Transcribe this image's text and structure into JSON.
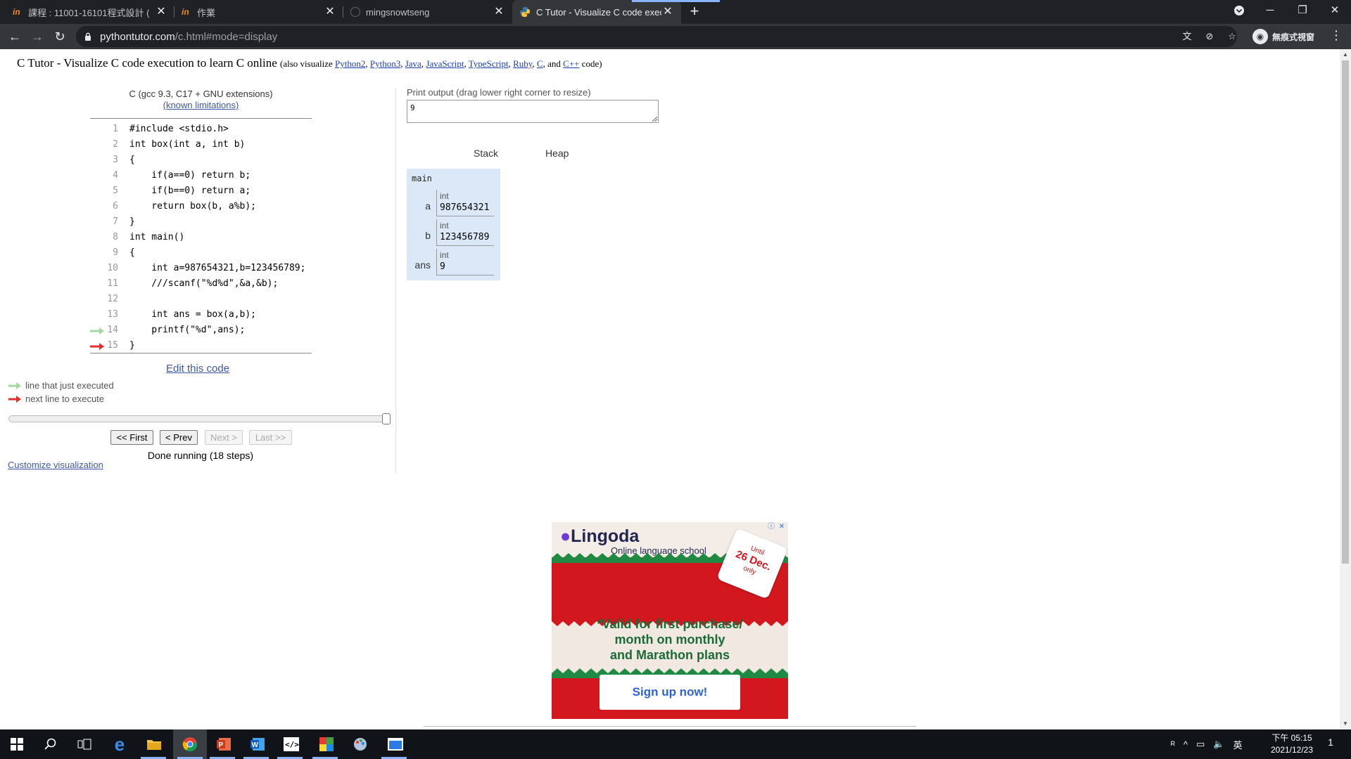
{
  "browser": {
    "tabs": [
      {
        "title": "課程 : 11001-16101程式設計 (",
        "favicon": "in-icon",
        "active": false
      },
      {
        "title": "作業",
        "favicon": "in-icon",
        "active": false
      },
      {
        "title": "mingsnowtseng",
        "favicon": "github-icon",
        "active": false
      },
      {
        "title": "C Tutor - Visualize C code exec",
        "favicon": "python-icon",
        "active": true
      }
    ],
    "new_tab": "+",
    "url_host": "pythontutor.com",
    "url_path": "/c.html#mode=display",
    "profile_label": "無痕式視窗",
    "accent": "#8ab4f8"
  },
  "page": {
    "title": "C Tutor - Visualize C code execution to learn C online",
    "also_prefix": "(also visualize ",
    "also_links": [
      "Python2",
      "Python3",
      "Java",
      "JavaScript",
      "TypeScript",
      "Ruby",
      "C"
    ],
    "also_and": "and",
    "also_last": "C++",
    "also_suffix": " code)",
    "language": "C (gcc 9.3, C17 + GNU extensions)",
    "limitations_link": "(known limitations)",
    "code_lines": [
      "#include <stdio.h>",
      "int box(int a, int b)",
      "{",
      "    if(a==0) return b;",
      "    if(b==0) return a;",
      "    return box(b, a%b);",
      "}",
      "int main()",
      "{",
      "    int a=987654321,b=123456789;",
      "    ///scanf(\"%d%d\",&a,&b);",
      "",
      "    int ans = box(a,b);",
      "    printf(\"%d\",ans);",
      "}"
    ],
    "just_executed_line": 14,
    "next_line": 15,
    "edit_link": "Edit this code",
    "legend_just_executed": "line that just executed",
    "legend_next": "next line to execute",
    "legend_colors": {
      "just_executed": "#a3d9a3",
      "next": "#e03030"
    },
    "slider_fraction": 1.0,
    "buttons": {
      "first": "<< First",
      "prev": "< Prev",
      "next": "Next >",
      "last": "Last >>"
    },
    "status": "Done running (18 steps)",
    "customize": "Customize visualization",
    "print_label": "Print output (drag lower right corner to resize)",
    "print_output": "9",
    "stack_label": "Stack",
    "heap_label": "Heap",
    "frame": {
      "name": "main",
      "vars": [
        {
          "name": "a",
          "type": "int",
          "value": "987654321"
        },
        {
          "name": "b",
          "type": "int",
          "value": "123456789"
        },
        {
          "name": "ans",
          "type": "int",
          "value": "9"
        }
      ]
    }
  },
  "ad": {
    "brand": "Lingoda",
    "tagline": "Online language school",
    "tag_line1": "Until",
    "tag_line2": "26 Dec.",
    "tag_line3": "only",
    "text_line1": "*Valid for first purchase/",
    "text_line2": "month on monthly",
    "text_line3": "and Marathon plans",
    "cta": "Sign up now!"
  },
  "taskbar": {
    "time": "下午 05:15",
    "date": "2021/12/23",
    "ime": "英",
    "notification_count": "1"
  }
}
